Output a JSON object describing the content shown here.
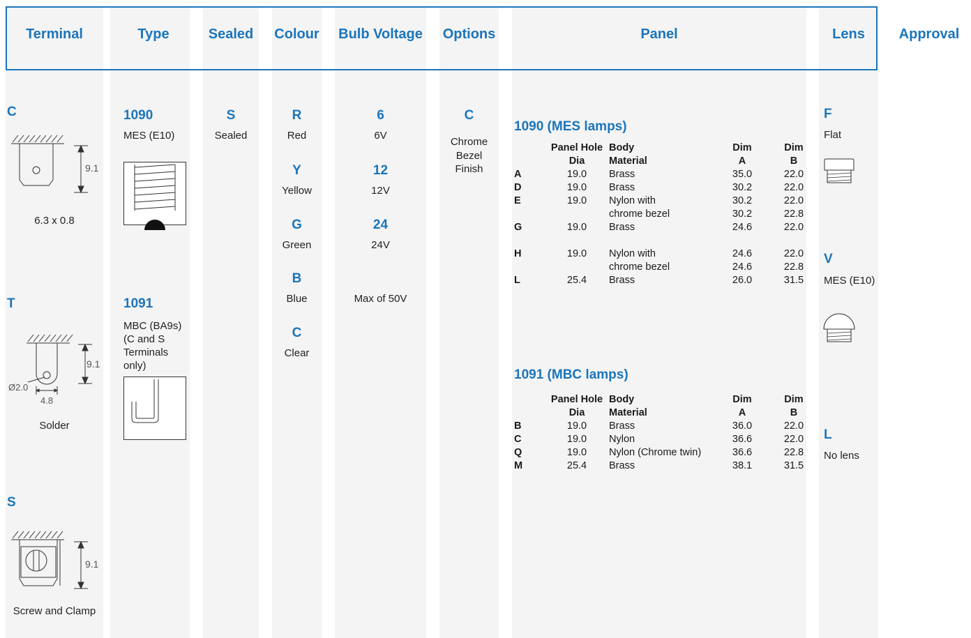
{
  "headers": {
    "terminal": "Terminal",
    "type": "Type",
    "sealed": "Sealed",
    "colour": "Colour",
    "bulb_voltage": "Bulb Voltage",
    "options": "Options",
    "panel": "Panel",
    "lens": "Lens",
    "approval": "Approval"
  },
  "terminal": {
    "c": {
      "code": "C",
      "dim": "9.1",
      "caption": "6.3 x 0.8"
    },
    "t": {
      "code": "T",
      "dim": "9.1",
      "hole": "Ø2.0",
      "width": "4.8",
      "caption": "Solder"
    },
    "s": {
      "code": "S",
      "dim": "9.1",
      "caption": "Screw and Clamp"
    }
  },
  "type": {
    "t1090": {
      "code": "1090",
      "desc": "MES (E10)"
    },
    "t1091": {
      "code": "1091",
      "desc_lines": [
        "MBC (BA9s)",
        "(C and S",
        "Terminals",
        "only)"
      ]
    }
  },
  "sealed": {
    "code": "S",
    "label": "Sealed"
  },
  "colour": [
    {
      "code": "R",
      "label": "Red"
    },
    {
      "code": "Y",
      "label": "Yellow"
    },
    {
      "code": "G",
      "label": "Green"
    },
    {
      "code": "B",
      "label": "Blue"
    },
    {
      "code": "C",
      "label": "Clear"
    }
  ],
  "voltage": [
    {
      "code": "6",
      "label": "6V"
    },
    {
      "code": "12",
      "label": "12V"
    },
    {
      "code": "24",
      "label": "24V"
    }
  ],
  "voltage_note": "Max of 50V",
  "options": {
    "code": "C",
    "lines": [
      "Chrome",
      "Bezel",
      "Finish"
    ]
  },
  "panel": {
    "mes": {
      "title": "1090 (MES lamps)",
      "head1": [
        "",
        "Panel Hole",
        "Body",
        "Dim",
        "Dim"
      ],
      "head2": [
        "",
        "Dia",
        "Material",
        "A",
        "B"
      ],
      "rows": [
        [
          "A",
          "19.0",
          "Brass",
          "35.0",
          "22.0"
        ],
        [
          "D",
          "19.0",
          "Brass",
          "30.2",
          "22.0"
        ],
        [
          "E",
          "19.0",
          "Nylon with",
          "30.2",
          "22.0"
        ],
        [
          "",
          "",
          "chrome bezel",
          "30.2",
          "22.8"
        ],
        [
          "G",
          "19.0",
          "Brass",
          "24.6",
          "22.0"
        ],
        [
          "",
          "",
          "",
          "",
          ""
        ],
        [
          "H",
          "19.0",
          "Nylon with",
          "24.6",
          "22.0"
        ],
        [
          "",
          "",
          "chrome bezel",
          "24.6",
          "22.8"
        ],
        [
          "L",
          "25.4",
          "Brass",
          "26.0",
          "31.5"
        ]
      ]
    },
    "mbc": {
      "title": "1091 (MBC lamps)",
      "head1": [
        "",
        "Panel Hole",
        "Body",
        "Dim",
        "Dim"
      ],
      "head2": [
        "",
        "Dia",
        "Material",
        "A",
        "B"
      ],
      "rows": [
        [
          "B",
          "19.0",
          "Brass",
          "36.0",
          "22.0"
        ],
        [
          "C",
          "19.0",
          "Nylon",
          "36.6",
          "22.0"
        ],
        [
          "Q",
          "19.0",
          "Nylon (Chrome twin)",
          "36.6",
          "22.8"
        ],
        [
          "M",
          "25.4",
          "Brass",
          "38.1",
          "31.5"
        ]
      ]
    }
  },
  "lens": [
    {
      "code": "F",
      "label": "Flat"
    },
    {
      "code": "V",
      "label": "MES (E10)"
    },
    {
      "code": "L",
      "label": "No lens"
    }
  ],
  "colors": {
    "accent": "#1b75bb",
    "column_bg": "#f4f4f4"
  }
}
